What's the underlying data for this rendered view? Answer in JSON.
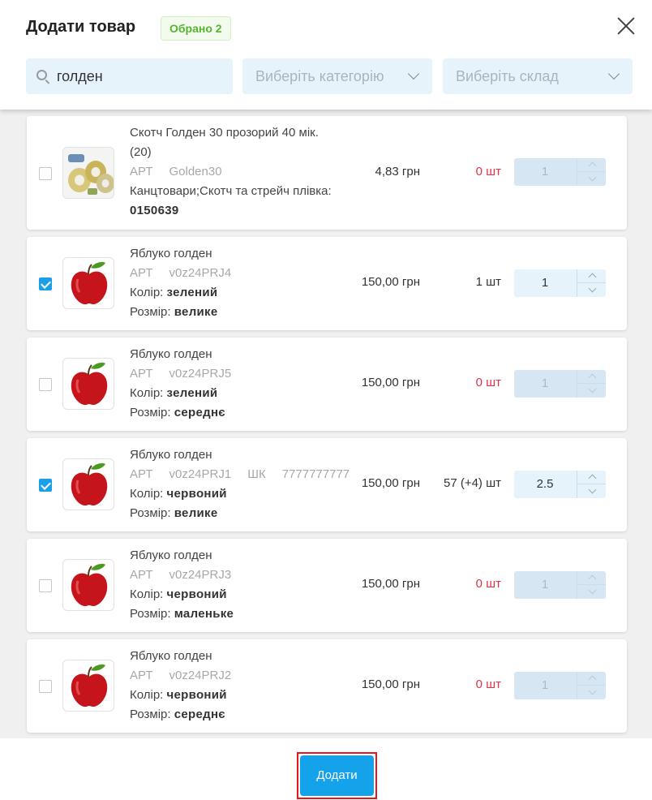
{
  "modal": {
    "title": "Додати товар",
    "selected_badge": "Обрано 2"
  },
  "filters": {
    "search_value": "голден",
    "category_placeholder": "Виберіть категорію",
    "warehouse_placeholder": "Виберіть склад"
  },
  "products": [
    {
      "name_line1": "Скотч Голден 30 прозорий 40 мік.",
      "name_line2": "(20)",
      "sku_label": "АРТ",
      "sku": "Golden30",
      "category": "Канцтовари;Скотч та стрейч плівка:",
      "code": "0150639",
      "price": "4,83 грн",
      "stock": "0 шт",
      "quantity": "1",
      "checked": false,
      "image": "tape-rolls"
    },
    {
      "name_line1": "Яблуко голден",
      "sku_label": "АРТ",
      "sku": "v0z24PRJ4",
      "color_label": "Колір:",
      "color": "зелений",
      "size_label": "Розмір:",
      "size": "велике",
      "price": "150,00 грн",
      "stock": "1 шт",
      "quantity": "1",
      "checked": true,
      "image": "apple"
    },
    {
      "name_line1": "Яблуко голден",
      "sku_label": "АРТ",
      "sku": "v0z24PRJ5",
      "color_label": "Колір:",
      "color": "зелений",
      "size_label": "Розмір:",
      "size": "середнє",
      "price": "150,00 грн",
      "stock": "0 шт",
      "quantity": "1",
      "checked": false,
      "image": "apple"
    },
    {
      "name_line1": "Яблуко голден",
      "sku_label": "АРТ",
      "sku": "v0z24PRJ1",
      "barcode_label": "ШК",
      "barcode": "7777777777",
      "color_label": "Колір:",
      "color": "червоний",
      "size_label": "Розмір:",
      "size": "велике",
      "price": "150,00 грн",
      "stock": "57 (+4) шт",
      "quantity": "2.5",
      "checked": true,
      "image": "apple"
    },
    {
      "name_line1": "Яблуко голден",
      "sku_label": "АРТ",
      "sku": "v0z24PRJ3",
      "color_label": "Колір:",
      "color": "червоний",
      "size_label": "Розмір:",
      "size": "маленьке",
      "price": "150,00 грн",
      "stock": "0 шт",
      "quantity": "1",
      "checked": false,
      "image": "apple"
    },
    {
      "name_line1": "Яблуко голден",
      "sku_label": "АРТ",
      "sku": "v0z24PRJ2",
      "color_label": "Колір:",
      "color": "червоний",
      "size_label": "Розмір:",
      "size": "середнє",
      "price": "150,00 грн",
      "stock": "0 шт",
      "quantity": "1",
      "checked": false,
      "image": "apple"
    }
  ],
  "footer": {
    "add_button": "Додати"
  },
  "colors": {
    "accent": "#14a3eb",
    "checkbox_checked": "#1b9fe8",
    "badge_text": "#56b431",
    "zero_stock": "#e0344b",
    "highlight_frame": "#e8141e"
  }
}
